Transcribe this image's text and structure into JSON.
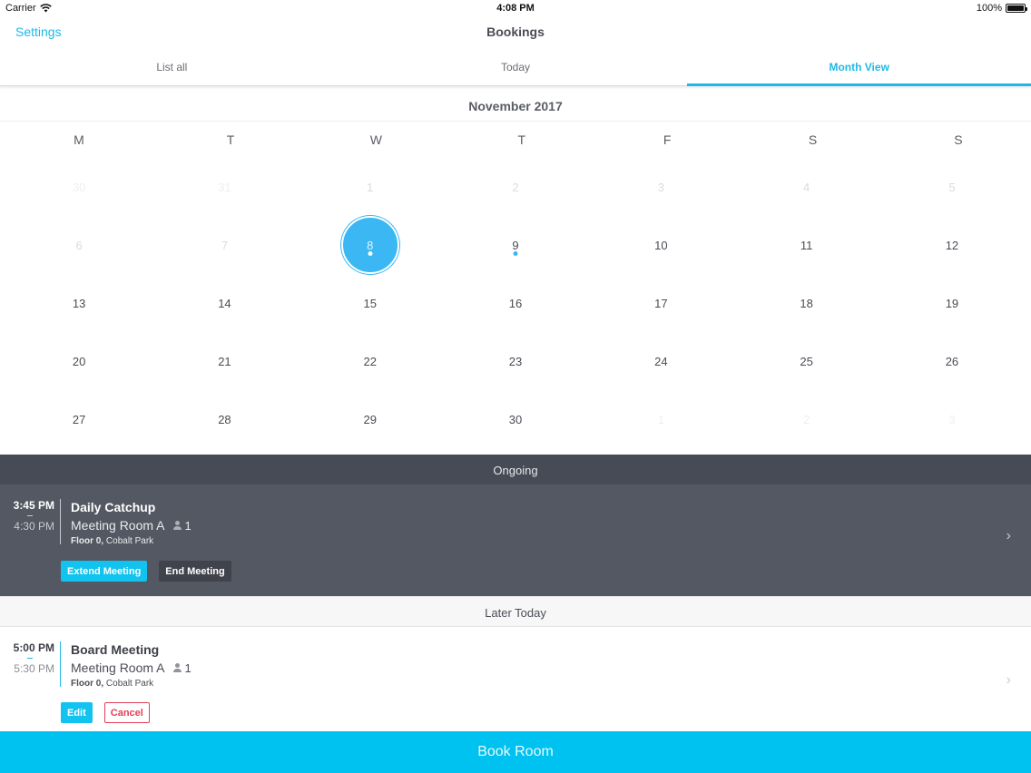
{
  "status_bar": {
    "carrier": "Carrier",
    "time": "4:08 PM",
    "battery": "100%",
    "battery_level": 1.0
  },
  "nav": {
    "back_label": "Settings",
    "title": "Bookings"
  },
  "tabs": [
    {
      "label": "List all",
      "active": false
    },
    {
      "label": "Today",
      "active": false
    },
    {
      "label": "Month View",
      "active": true
    }
  ],
  "calendar": {
    "month": "November 2017",
    "weekdays": [
      "M",
      "T",
      "W",
      "T",
      "F",
      "S",
      "S"
    ],
    "days": [
      {
        "label": "30",
        "state": "muted-faint"
      },
      {
        "label": "31",
        "state": "muted-faint"
      },
      {
        "label": "1",
        "state": "muted"
      },
      {
        "label": "2",
        "state": "muted"
      },
      {
        "label": "3",
        "state": "muted"
      },
      {
        "label": "4",
        "state": "muted"
      },
      {
        "label": "5",
        "state": "muted"
      },
      {
        "label": "6",
        "state": "muted"
      },
      {
        "label": "7",
        "state": "muted"
      },
      {
        "label": "8",
        "state": "selected",
        "event": true
      },
      {
        "label": "9",
        "state": "normal",
        "event": true
      },
      {
        "label": "10",
        "state": "normal"
      },
      {
        "label": "11",
        "state": "normal"
      },
      {
        "label": "12",
        "state": "normal"
      },
      {
        "label": "13",
        "state": "normal"
      },
      {
        "label": "14",
        "state": "normal"
      },
      {
        "label": "15",
        "state": "normal"
      },
      {
        "label": "16",
        "state": "normal"
      },
      {
        "label": "17",
        "state": "normal"
      },
      {
        "label": "18",
        "state": "normal"
      },
      {
        "label": "19",
        "state": "normal"
      },
      {
        "label": "20",
        "state": "normal"
      },
      {
        "label": "21",
        "state": "normal"
      },
      {
        "label": "22",
        "state": "normal"
      },
      {
        "label": "23",
        "state": "normal"
      },
      {
        "label": "24",
        "state": "normal"
      },
      {
        "label": "25",
        "state": "normal"
      },
      {
        "label": "26",
        "state": "normal"
      },
      {
        "label": "27",
        "state": "normal"
      },
      {
        "label": "28",
        "state": "normal"
      },
      {
        "label": "29",
        "state": "normal"
      },
      {
        "label": "30",
        "state": "normal"
      },
      {
        "label": "1",
        "state": "muted-faint"
      },
      {
        "label": "2",
        "state": "muted-faint"
      },
      {
        "label": "3",
        "state": "muted-faint"
      }
    ]
  },
  "ongoing": {
    "header": "Ongoing",
    "booking": {
      "start": "3:45 PM",
      "end": "4:30 PM",
      "title": "Daily Catchup",
      "room": "Meeting Room A",
      "attendees": "1",
      "floor": "Floor 0,",
      "location": "Cobalt Park",
      "actions": {
        "extend": "Extend Meeting",
        "end": "End Meeting"
      },
      "chevron": "›"
    }
  },
  "later": {
    "header": "Later Today",
    "booking": {
      "start": "5:00 PM",
      "end": "5:30 PM",
      "title": "Board Meeting",
      "room": "Meeting Room A",
      "attendees": "1",
      "floor": "Floor 0,",
      "location": "Cobalt Park",
      "actions": {
        "edit": "Edit",
        "cancel": "Cancel"
      },
      "chevron": "›"
    }
  },
  "footer": {
    "book_room": "Book Room"
  },
  "colors": {
    "accent": "#1fb9e6",
    "selected_day": "#3bb8f3",
    "ongoing_bg": "#545862",
    "cancel": "#e3405a",
    "book_room_bg": "#00c2f0"
  },
  "icons": {
    "wifi": "wifi-icon",
    "battery": "battery-icon",
    "person": "person-icon",
    "chevron": "chevron-right-icon"
  }
}
